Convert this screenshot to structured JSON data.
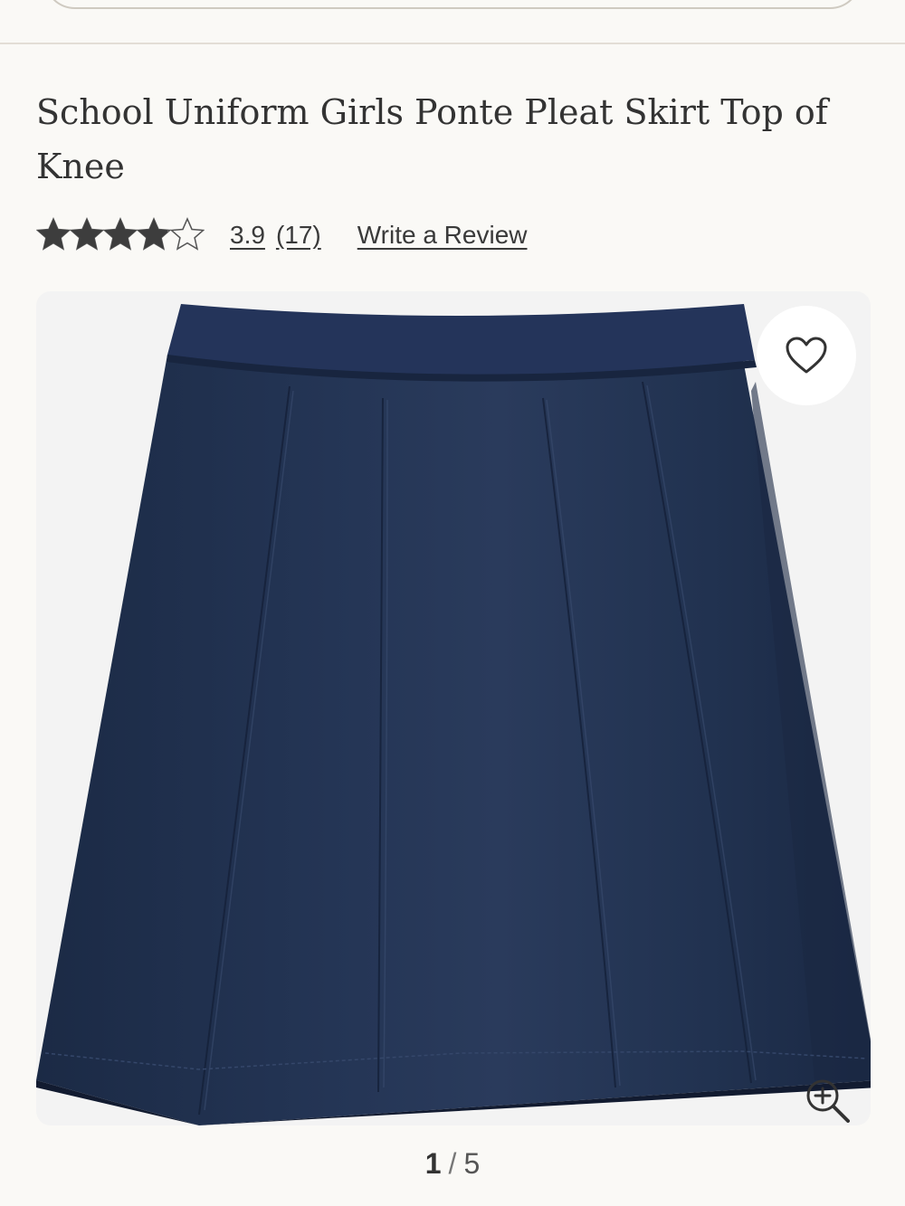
{
  "product": {
    "title": "School Uniform Girls Ponte Pleat Skirt Top of Knee",
    "rating": {
      "value": "3.9",
      "count_label": "(17)",
      "stars_filled_fraction": 0.78,
      "max_stars": 5
    },
    "write_review_label": "Write a Review"
  },
  "gallery": {
    "current_page": "1",
    "separator": "/",
    "total_pages": "5",
    "image_description": "Navy blue pleated ponte skirt",
    "favorite_icon": "heart-outline-icon",
    "zoom_icon": "zoom-in-icon"
  },
  "colors": {
    "background": "#faf9f6",
    "skirt_navy": "#1e2d4a",
    "text": "#333333"
  }
}
